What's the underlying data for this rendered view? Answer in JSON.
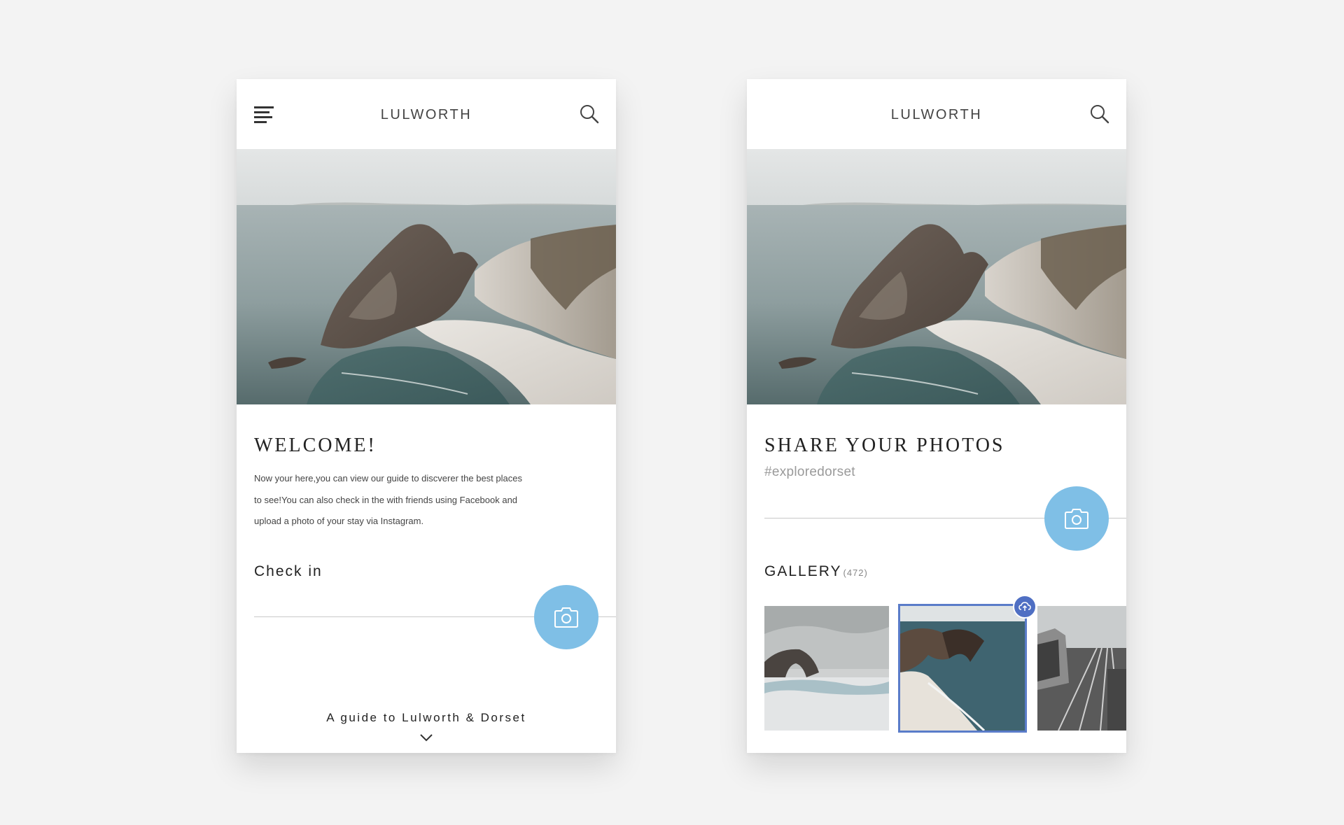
{
  "screens": [
    {
      "header": {
        "title": "LULWORTH",
        "menu_icon": "menu-icon",
        "search_icon": "search-icon"
      },
      "welcome": {
        "title": "WELCOME!",
        "text_line1": "Now your here,you can view our guide to discverer the best places",
        "text_line2": "to see!You can also check in the with friends using Facebook and",
        "text_line3": "upload a photo of your stay via Instagram."
      },
      "checkin_label": "Check in",
      "camera_icon": "camera-icon",
      "footer": {
        "guide_text": "A guide to Lulworth & Dorset",
        "chevron_icon": "chevron-down-icon"
      }
    },
    {
      "header": {
        "title": "LULWORTH",
        "search_icon": "search-icon"
      },
      "share": {
        "title": "SHARE YOUR PHOTOS",
        "hashtag": "#exploredorset"
      },
      "camera_icon": "camera-icon",
      "gallery": {
        "label": "GALLERY",
        "count": "(472)",
        "selected_index": 1,
        "upload_icon": "cloud-upload-icon"
      }
    }
  ],
  "colors": {
    "background": "#f3f3f3",
    "card": "#ffffff",
    "camera_button": "#7fbfe6",
    "selection_outline": "#5a7cc9",
    "upload_badge": "#4f6fc3",
    "hashtag": "#9a9a9a"
  }
}
